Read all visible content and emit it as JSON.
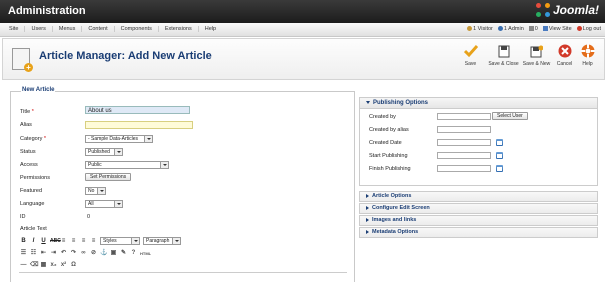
{
  "app": {
    "title": "Administration",
    "brand": "Joomla!"
  },
  "menu": {
    "items": [
      "Site",
      "Users",
      "Menus",
      "Content",
      "Components",
      "Extensions",
      "Help"
    ]
  },
  "status": {
    "visitors": "1 Visitor",
    "admins": "1 Admin",
    "messages": "0",
    "view_site": "View Site",
    "logout": "Log out"
  },
  "header": {
    "title": "Article Manager: Add New Article"
  },
  "toolbar": {
    "save": "Save",
    "save_close": "Save & Close",
    "save_new": "Save & New",
    "cancel": "Cancel",
    "help": "Help"
  },
  "form": {
    "legend": "New Article",
    "title_label": "Title",
    "title_value": "About us",
    "alias_label": "Alias",
    "alias_value": "",
    "category_label": "Category",
    "category_value": "- Sample Data-Articles",
    "status_label": "Status",
    "status_value": "Published",
    "access_label": "Access",
    "access_value": "Public",
    "permissions_label": "Permissions",
    "permissions_button": "Set Permissions",
    "featured_label": "Featured",
    "featured_value": "No",
    "language_label": "Language",
    "language_value": "All",
    "id_label": "ID",
    "id_value": "0",
    "article_text_label": "Article Text",
    "styles_value": "Styles",
    "paragraph_value": "Paragraph"
  },
  "publishing": {
    "heading": "Publishing Options",
    "created_by": "Created by",
    "select_user": "Select User",
    "created_by_alias": "Created by alias",
    "created_date": "Created Date",
    "start_publishing": "Start Publishing",
    "finish_publishing": "Finish Publishing"
  },
  "panels": [
    "Article Options",
    "Configure Edit Screen",
    "Images and links",
    "Metadata Options"
  ],
  "colors": {
    "heading_blue": "#1a3d74",
    "save_yellow": "#e8a21a",
    "cancel_red": "#d23a2a",
    "help_orange": "#e46d1b"
  }
}
